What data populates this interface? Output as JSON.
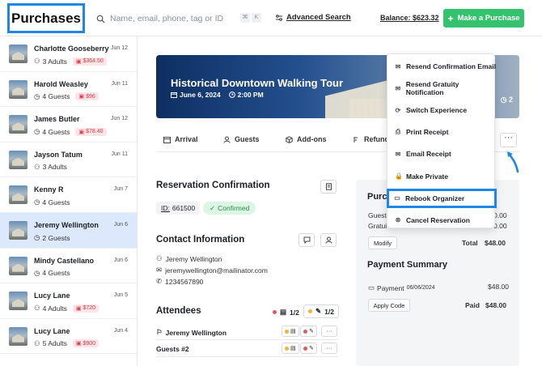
{
  "header": {
    "title": "Purchases",
    "search_placeholder": "Name, email, phone, tag or ID",
    "kbd_1": "⌘",
    "kbd_2": "K",
    "advanced_search": "Advanced Search",
    "balance": "Balance: $623.32",
    "make_purchase": "Make a Purchase"
  },
  "purchases": [
    {
      "name": "Charlotte Gooseberry",
      "date": "Jun 12",
      "guests": "3 Adults",
      "badge": "$364.50",
      "guest_icon": "person-icon"
    },
    {
      "name": "Harold Weasley",
      "date": "Jun 11",
      "guests": "4 Guests",
      "badge": "$96",
      "guest_icon": "clock-icon"
    },
    {
      "name": "James Butler",
      "date": "Jun 12",
      "guests": "4 Guests",
      "badge": "$78.40",
      "guest_icon": "clock-icon"
    },
    {
      "name": "Jayson Tatum",
      "date": "Jun 11",
      "guests": "3 Adults",
      "badge": "",
      "guest_icon": "person-icon"
    },
    {
      "name": "Kenny R",
      "date": "Jun 7",
      "guests": "4 Guests",
      "badge": "",
      "guest_icon": "clock-icon"
    },
    {
      "name": "Jeremy Wellington",
      "date": "Jun 6",
      "guests": "2 Guests",
      "badge": "",
      "guest_icon": "clock-icon"
    },
    {
      "name": "Mindy Castellano",
      "date": "Jun 6",
      "guests": "4 Guests",
      "badge": "",
      "guest_icon": "clock-icon"
    },
    {
      "name": "Lucy Lane",
      "date": "Jun 5",
      "guests": "4 Adults",
      "badge": "$720",
      "guest_icon": "person-icon"
    },
    {
      "name": "Lucy Lane",
      "date": "Jun 4",
      "guests": "5 Adults",
      "badge": "$900",
      "guest_icon": "person-icon"
    }
  ],
  "selected_index": 5,
  "hero": {
    "title": "Historical Downtown Walking Tour",
    "date": "June 6, 2024",
    "time": "2:00 PM",
    "right_count": "2"
  },
  "tabs": [
    "Arrival",
    "Guests",
    "Add-ons",
    "Refund"
  ],
  "more_label": "···",
  "reservation": {
    "heading": "Reservation Confirmation",
    "id_label": "ID:",
    "id_value": "661500",
    "status": "Confirmed"
  },
  "contact": {
    "heading": "Contact Information",
    "name": "Jeremy Wellington",
    "email": "jeremywellington@mailinator.com",
    "phone": "1234567890"
  },
  "attendees": {
    "heading": "Attendees",
    "count_a": "1/2",
    "count_b": "1/2",
    "rows": [
      {
        "name": "Jeremy Wellington"
      },
      {
        "name": "Guests #2"
      }
    ]
  },
  "panel": {
    "purchase_heading": "Purc",
    "guests_label": "Guest",
    "guests_value": "0.00",
    "gratuity_label": "Gratui",
    "gratuity_value": "0.00",
    "modify": "Modify",
    "total_label": "Total",
    "total_value": "$48.00",
    "payment_heading": "Payment Summary",
    "payment_label": "Payment",
    "payment_date": "06/06/2024",
    "payment_value": "$48.00",
    "apply_code": "Apply Code",
    "paid_label": "Paid",
    "paid_value": "$48.00"
  },
  "menu": [
    {
      "label": "Resend Confirmation Email",
      "icon": "mail-icon"
    },
    {
      "label": "Resend Gratuity Notification",
      "icon": "mail-icon"
    },
    {
      "label": "Switch Experience",
      "icon": "refresh-icon"
    },
    {
      "label": "Print Receipt",
      "icon": "print-icon"
    },
    {
      "label": "Email Receipt",
      "icon": "mail-icon"
    },
    {
      "label": "Make Private",
      "icon": "lock-icon"
    },
    {
      "label": "Rebook Organizer",
      "icon": "ticket-icon"
    },
    {
      "label": "Cancel Reservation",
      "icon": "cancel-icon"
    }
  ],
  "highlighted_menu_index": 6,
  "colors": {
    "accent_blue": "#1f86e5",
    "primary_green": "#34c26e",
    "selected_row": "#dce8fb",
    "badge_red": "#d63b4a",
    "confirmed_green": "#2a8a4f"
  }
}
